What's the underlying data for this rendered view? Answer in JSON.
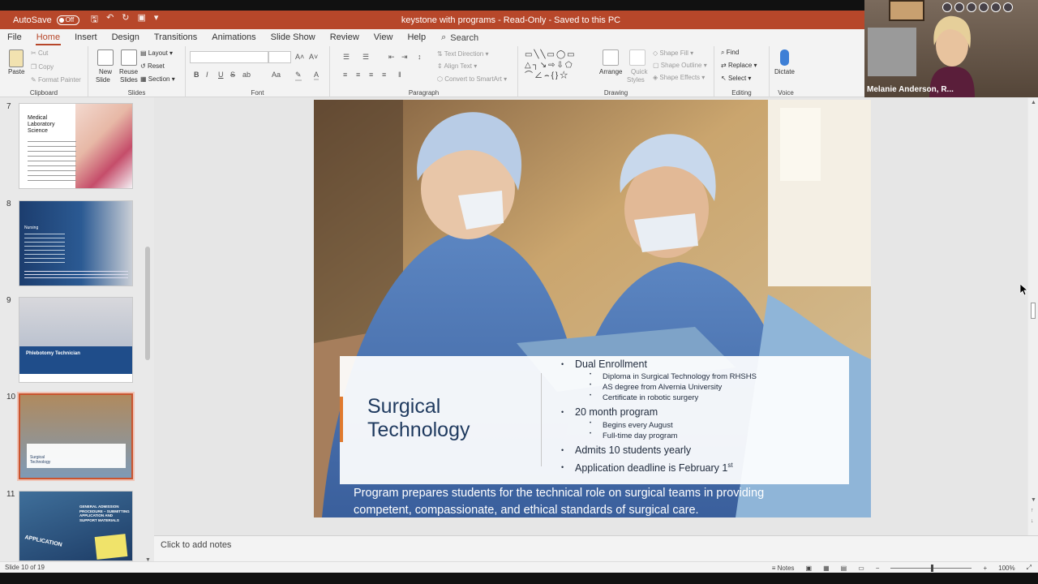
{
  "titlebar": {
    "autosave_label": "AutoSave",
    "toggle_state": "Off",
    "document_title": "keystone with programs  -  Read-Only  -  Saved to this PC"
  },
  "menu": {
    "tabs": [
      "File",
      "Home",
      "Insert",
      "Design",
      "Transitions",
      "Animations",
      "Slide Show",
      "Review",
      "View",
      "Help"
    ],
    "active_tab": "Home",
    "search_label": "Search"
  },
  "ribbon": {
    "clipboard": {
      "paste": "Paste",
      "cut": "Cut",
      "copy": "Copy",
      "format_painter": "Format Painter",
      "label": "Clipboard"
    },
    "slides": {
      "new_slide": "New",
      "new_slide2": "Slide",
      "reuse": "Reuse",
      "reuse2": "Slides",
      "layout": "Layout",
      "reset": "Reset",
      "section": "Section",
      "label": "Slides"
    },
    "font": {
      "label": "Font"
    },
    "paragraph": {
      "text_direction": "Text Direction",
      "align_text": "Align Text",
      "convert_smartart": "Convert to SmartArt",
      "label": "Paragraph"
    },
    "drawing": {
      "arrange": "Arrange",
      "quick_styles": "Quick",
      "quick_styles2": "Styles",
      "shape_fill": "Shape Fill",
      "shape_outline": "Shape Outline",
      "shape_effects": "Shape Effects",
      "label": "Drawing"
    },
    "editing": {
      "find": "Find",
      "replace": "Replace",
      "select": "Select",
      "label": "Editing"
    },
    "voice": {
      "dictate": "Dictate",
      "label": "Voice"
    }
  },
  "video": {
    "participant_name": "Melanie Anderson, R..."
  },
  "thumbnails": [
    {
      "num": "7",
      "title": "Medical Laboratory Science"
    },
    {
      "num": "8",
      "title": "Nursing"
    },
    {
      "num": "9",
      "title": "Phlebotomy Technician"
    },
    {
      "num": "10",
      "title": "Surgical Technology"
    },
    {
      "num": "11",
      "title": "GENERAL ADMISSION PROCEDURE – SUBMITTING APPLICATION AND SUPPORT MATERIALS",
      "subtitle": "APPLICATION"
    }
  ],
  "slide": {
    "title_line1": "Surgical",
    "title_line2": "Technology",
    "bullets": [
      {
        "text": "Dual Enrollment",
        "sub": [
          "Diploma in Surgical Technology from RHSHS",
          "AS degree from Alvernia University",
          "Certificate in robotic surgery"
        ]
      },
      {
        "text": "20 month program",
        "sub": [
          "Begins every August",
          "Full-time day program"
        ]
      },
      {
        "text": "Admits 10 students yearly",
        "sub": []
      },
      {
        "text": "Application deadline is February 1",
        "sup": "st",
        "sub": []
      }
    ],
    "description_line1": "Program prepares students for the technical role on surgical teams in providing",
    "description_line2": "competent, compassionate, and ethical standards of surgical care."
  },
  "notes": {
    "placeholder": "Click to add notes"
  },
  "status": {
    "slide_info": "Slide 10 of 19",
    "notes_label": "Notes",
    "zoom": "100%"
  }
}
